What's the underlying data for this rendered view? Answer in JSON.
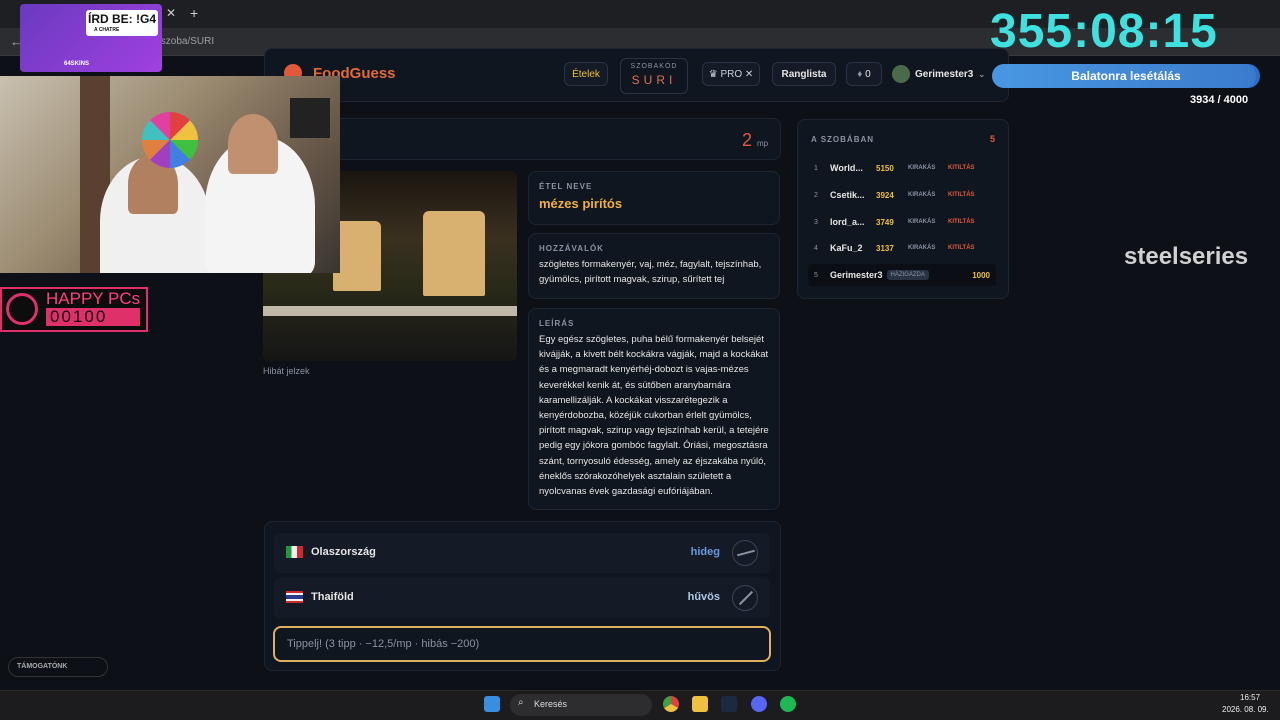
{
  "browser": {
    "address": "/szoba/SURI"
  },
  "header": {
    "app_name": "FoodGuess",
    "foods_button": "Ételek",
    "room_code_label": "SZOBAKÓD",
    "room_code": "SURI",
    "pro_label": "PRO",
    "leaderboard_button": "Ranglista",
    "score": "0",
    "username": "Gerimester3"
  },
  "round": {
    "timer": "2",
    "timer_unit": "mp"
  },
  "food": {
    "name_label": "ÉTEL NEVE",
    "name": "mézes pirítós",
    "ingredients_label": "HOZZÁVALÓK",
    "ingredients": "szögletes formakenyér, vaj, méz, fagylalt, tejszínhab, gyümölcs, pirított magvak, szirup, sűrített tej",
    "description_label": "LEÍRÁS",
    "description": "Egy egész szögletes, puha bélű formakenyér belsejét kivájják, a kivett bélt kockákra vágják, majd a kockákat és a megmaradt kenyérhéj-dobozt is vajas-mézes keverékkel kenik át, és sütőben aranybarnára karamellizálják. A kockákat visszarétegezik a kenyérdobozba, közéjük cukorban érlelt gyümölcs, pirított magvak, szirup vagy tejszínhab kerül, a tetejére pedig egy jókora gombóc fagylalt. Óriási, megosztásra szánt, tornyosuló édesség, amely az éjszakába nyúló, éneklős szórakozóhelyek asztalain született a nyolcvanas évek gazdasági eufóriájában.",
    "report_link": "Hibát jelzek"
  },
  "guesses": [
    {
      "country": "Olaszország",
      "hint": "hideg",
      "hint_color": "#6a9ae0"
    },
    {
      "country": "Thaiföld",
      "hint": "hűvös",
      "hint_color": "#b0c8e8"
    }
  ],
  "guess_input": {
    "placeholder": "Tippelj! (3 tipp · −12,5/mp · hibás −200)"
  },
  "room": {
    "title": "A SZOBÁBAN",
    "count": "5",
    "kick_label": "KIRAKÁS",
    "ban_label": "KITILTÁS",
    "host_label": "HÁZIGAZDA",
    "players": [
      {
        "rank": "1",
        "name": "World...",
        "score": "5150"
      },
      {
        "rank": "2",
        "name": "Csetik...",
        "score": "3924"
      },
      {
        "rank": "3",
        "name": "lord_a...",
        "score": "3749"
      },
      {
        "rank": "4",
        "name": "KaFu_2",
        "score": "3137"
      },
      {
        "rank": "5",
        "name": "Gerimester3",
        "score": "1000"
      }
    ]
  },
  "overlay": {
    "clock": "355:08:15",
    "goal_title": "Balatonra lesétálás",
    "goal_progress": "3934 / 4000",
    "goal_fraction": 0.9835,
    "banner": "ÍRD BE: !G4",
    "banner_sub": "A CHATRE",
    "sponsor_tag": "64SKINS",
    "happy_line1": "HAPPY PCs",
    "happy_line2": "00100",
    "steelseries": "steelseries",
    "support_label": "TÁMOGATÓNK"
  },
  "taskbar": {
    "search": "Keresés",
    "time": "16:57",
    "date": "2026. 08. 09."
  }
}
